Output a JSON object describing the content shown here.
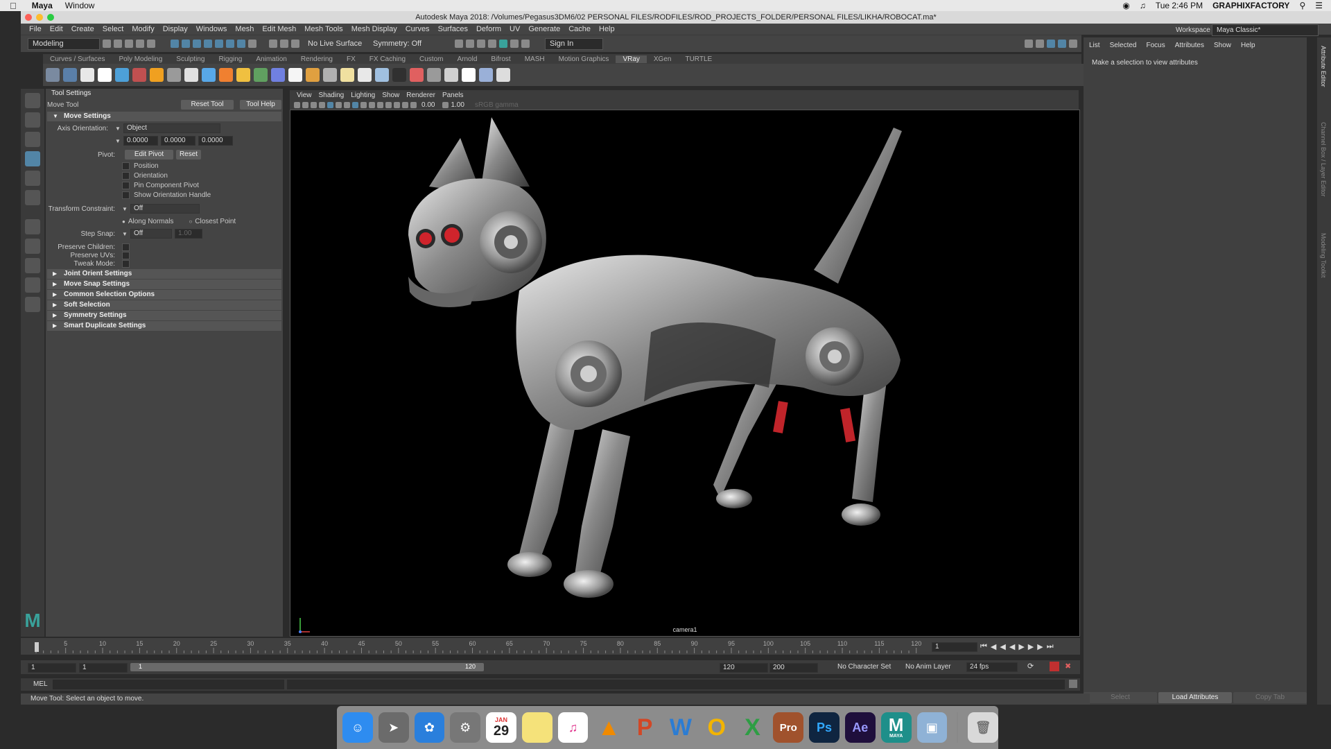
{
  "macos": {
    "app_name": "Maya",
    "menu_window": "Window",
    "clock": "Tue 2:46 PM",
    "user": "GRAPHIXFACTORY"
  },
  "window": {
    "title": "Autodesk Maya 2018: /Volumes/Pegasus3DM6/02 PERSONAL FILES/RODFILES/ROD_PROJECTS_FOLDER/PERSONAL FILES/LIKHA/ROBOCAT.ma*"
  },
  "main_menu": [
    "File",
    "Edit",
    "Create",
    "Select",
    "Modify",
    "Display",
    "Windows",
    "Mesh",
    "Edit Mesh",
    "Mesh Tools",
    "Mesh Display",
    "Curves",
    "Surfaces",
    "Deform",
    "UV",
    "Generate",
    "Cache",
    "Help"
  ],
  "status_line": {
    "menu_set": "Modeling",
    "live_surface": "No Live Surface",
    "symmetry": "Symmetry: Off",
    "sign_in": "Sign In"
  },
  "workspace": {
    "label": "Workspace :",
    "value": "Maya Classic*"
  },
  "shelf_tabs": [
    "Curves / Surfaces",
    "Poly Modeling",
    "Sculpting",
    "Rigging",
    "Animation",
    "Rendering",
    "FX",
    "FX Caching",
    "Custom",
    "Arnold",
    "Bifrost",
    "MASH",
    "Motion Graphics",
    "VRay",
    "XGen",
    "TURTLE"
  ],
  "shelf_active_tab": "VRay",
  "tool_settings": {
    "panel_title": "Tool Settings",
    "tool_name": "Move Tool",
    "reset_tool": "Reset Tool",
    "tool_help": "Tool Help",
    "move_settings": "Move Settings",
    "axis_orientation_label": "Axis Orientation:",
    "axis_orientation_value": "Object",
    "xyz": [
      "0.0000",
      "0.0000",
      "0.0000"
    ],
    "pivot_label": "Pivot:",
    "edit_pivot": "Edit Pivot",
    "reset": "Reset",
    "pivot_options": [
      "Position",
      "Orientation",
      "Pin Component Pivot",
      "Show Orientation Handle"
    ],
    "transform_constraint_label": "Transform Constraint:",
    "transform_constraint_value": "Off",
    "along_normals": "Along Normals",
    "closest_point": "Closest Point",
    "step_snap_label": "Step Snap:",
    "step_snap_value": "Off",
    "step_snap_amount": "1.00",
    "preserve_children": "Preserve Children:",
    "preserve_uvs": "Preserve UVs:",
    "tweak_mode": "Tweak Mode:",
    "sections": [
      "Joint Orient Settings",
      "Move Snap Settings",
      "Common Selection Options",
      "Soft Selection",
      "Symmetry Settings",
      "Smart Duplicate Settings"
    ]
  },
  "viewport": {
    "menu": [
      "View",
      "Shading",
      "Lighting",
      "Show",
      "Renderer",
      "Panels"
    ],
    "exposure": "0.00",
    "gamma": "1.00",
    "color_space": "sRGB gamma",
    "camera": "camera1"
  },
  "attribute_editor": {
    "nav": [
      "List",
      "Selected",
      "Focus",
      "Attributes",
      "Show",
      "Help"
    ],
    "message": "Make a selection to view attributes",
    "buttons": [
      "Select",
      "Load Attributes",
      "Copy Tab"
    ],
    "side_tabs": [
      "Attribute Editor",
      "Channel Box / Layer Editor",
      "Modeling Toolkit"
    ]
  },
  "timeline": {
    "ticks": [
      "5",
      "10",
      "15",
      "20",
      "25",
      "30",
      "35",
      "40",
      "45",
      "50",
      "55",
      "60",
      "65",
      "70",
      "75",
      "80",
      "85",
      "90",
      "95",
      "100",
      "105",
      "110",
      "115",
      "120"
    ],
    "current_frame": "1",
    "range_start": "1",
    "range_start2": "1",
    "slider_start": "1",
    "slider_end": "120",
    "range_end": "120",
    "anim_end": "200",
    "character_set": "No Character Set",
    "anim_layer": "No Anim Layer",
    "fps": "24 fps"
  },
  "command_line": {
    "label": "MEL"
  },
  "help_line": "Move Tool: Select an object to move.",
  "dock": {
    "calendar_month": "JAN",
    "calendar_day": "29",
    "items": [
      "finder-icon",
      "launchpad-icon",
      "safari-icon",
      "system-preferences-icon",
      "calendar-icon",
      "notes-icon",
      "itunes-icon",
      "vlc-icon",
      "powerpoint-icon",
      "word-icon",
      "outlook-icon",
      "excel-icon",
      "pro-icon",
      "photoshop-icon",
      "after-effects-icon",
      "maya-icon",
      "preview-icon",
      "trash-icon"
    ],
    "labels": {
      "pro": "Pro",
      "ps": "Ps",
      "ae": "Ae",
      "maya": "MAYA"
    }
  }
}
